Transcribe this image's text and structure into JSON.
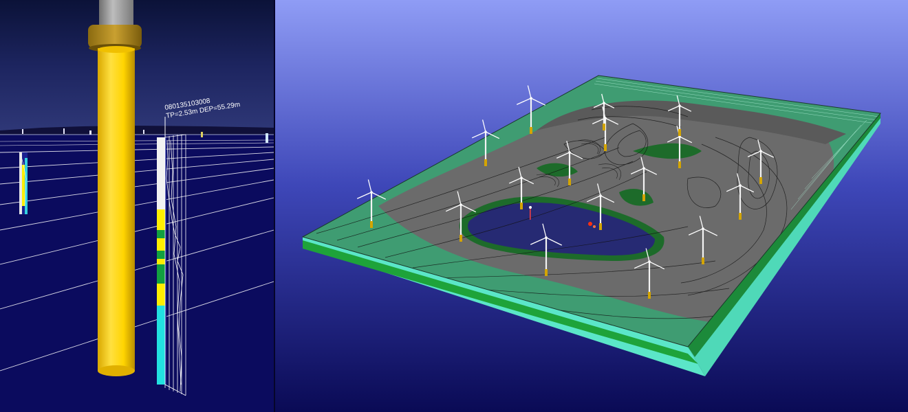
{
  "left_view": {
    "borehole": {
      "id": "080135103008",
      "details": "TP=2.53m DEP=55.29m"
    }
  },
  "colors": {
    "sky_top": "#0b1238",
    "sky_bottom": "#2a3070",
    "sea": "#0b0b5e",
    "pile": "#ffd400",
    "pile_shade": "#c99e00",
    "collar": "#b58f1c",
    "mast": "#a8a8a8",
    "layer_white": "#f2f2f2",
    "layer_yellow": "#ffee00",
    "layer_green": "#12a040",
    "layer_cyan": "#22e0e0",
    "bg_top": "#8f9cf5",
    "bg_bottom": "#0a0a55",
    "grey_sediment": "#6b6b6b",
    "green_sediment": "#3f9c72",
    "dark_green": "#1d6b2a",
    "blue_basin": "#262a73",
    "slab_side_cyan": "#5be6c8",
    "slab_side_green": "#1ea33a",
    "slab_side_white": "#cfcfcf"
  },
  "right_view": {
    "turbine_icon": "wind-turbine-icon",
    "turbine_count": 17
  }
}
